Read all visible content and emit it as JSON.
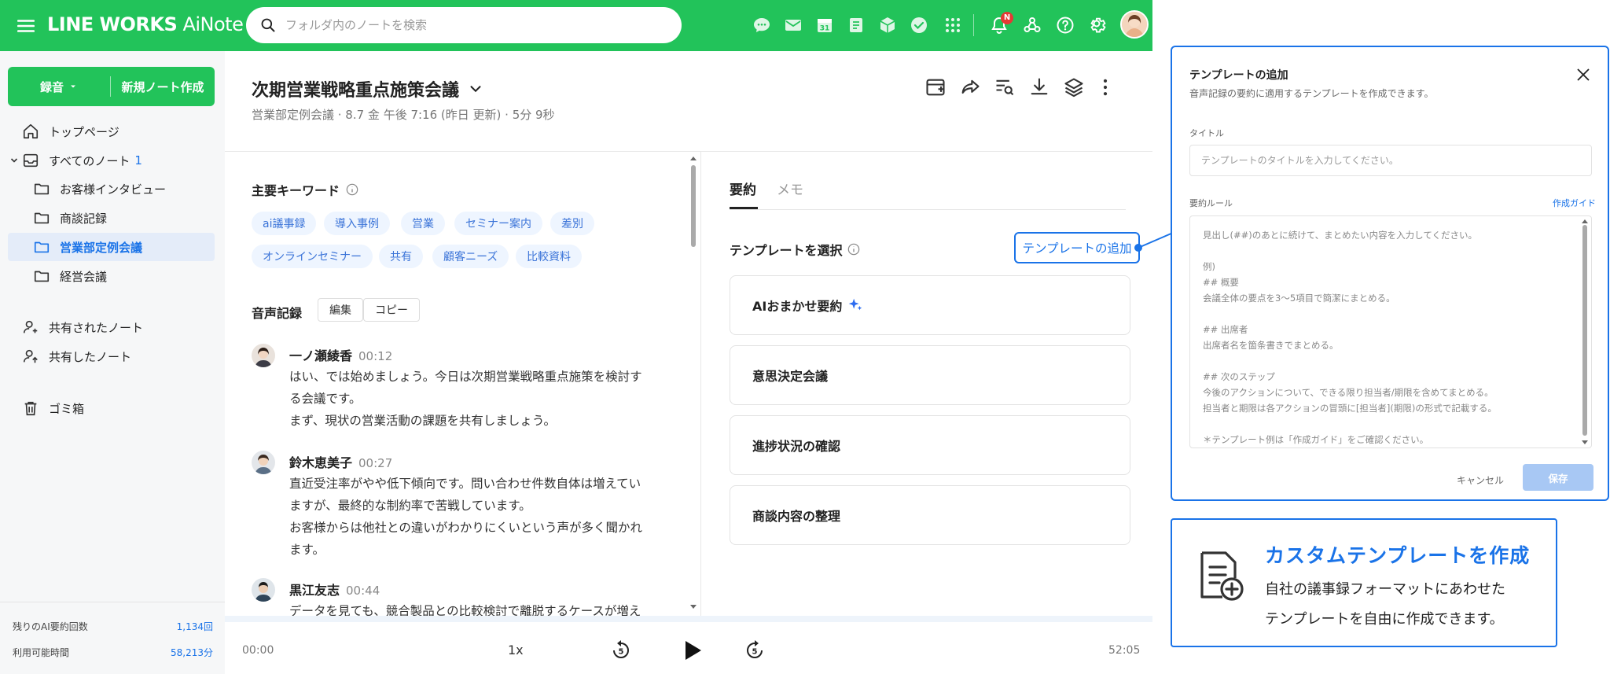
{
  "topbar": {
    "brand": "LINE WORKS",
    "product": "AiNote",
    "search_placeholder": "フォルダ内のノートを検索",
    "notification_badge": "N"
  },
  "sidebar": {
    "record_label": "録音",
    "new_note_label": "新規ノート作成",
    "items": [
      {
        "label": "トップページ"
      },
      {
        "label": "すべてのノート",
        "count": "1"
      },
      {
        "label": "お客様インタビュー"
      },
      {
        "label": "商談記録"
      },
      {
        "label": "営業部定例会議"
      },
      {
        "label": "経営会議"
      },
      {
        "label": "共有されたノート"
      },
      {
        "label": "共有したノート"
      },
      {
        "label": "ゴミ箱"
      }
    ],
    "stats": [
      {
        "label": "残りのAI要約回数",
        "value": "1,134回"
      },
      {
        "label": "利用可能時間",
        "value": "58,213分"
      }
    ]
  },
  "note": {
    "title": "次期営業戦略重点施策会議",
    "meta": "営業部定例会議 · 8.7 金 午後 7:16 (昨日 更新) · 5分 9秒"
  },
  "keywords": {
    "heading": "主要キーワード",
    "items": [
      "ai議事録",
      "導入事例",
      "営業",
      "セミナー案内",
      "差別",
      "オンラインセミナー",
      "共有",
      "顧客ニーズ",
      "比較資料"
    ]
  },
  "transcript": {
    "heading": "音声記録",
    "edit_label": "編集",
    "copy_label": "コピー",
    "entries": [
      {
        "speaker": "一ノ瀬綾香",
        "time": "00:12",
        "lines": [
          "はい、では始めましょう。今日は次期営業戦略重点施策を検討す",
          "る会議です。",
          "まず、現状の営業活動の課題を共有しましょう。"
        ]
      },
      {
        "speaker": "鈴木恵美子",
        "time": "00:27",
        "lines": [
          "直近受注率がやや低下傾向です。問い合わせ件数自体は増えてい",
          "ますが、最終的な制約率で苦戦しています。",
          "お客様からは他社との違いがわかりにくいという声が多く聞かれ",
          "ます。"
        ]
      },
      {
        "speaker": "黒江友志",
        "time": "00:44",
        "lines": [
          "データを見ても、競合製品との比較検討で離脱するケースが増え"
        ]
      }
    ]
  },
  "summary": {
    "tab_summary": "要約",
    "tab_memo": "メモ",
    "select_label": "テンプレートを選択",
    "add_template_label": "テンプレートの追加",
    "templates": [
      "AIおまかせ要約",
      "意思決定会議",
      "進捗状況の確認",
      "商談内容の整理"
    ]
  },
  "player": {
    "current": "00:00",
    "speed": "1x",
    "total": "52:05"
  },
  "modal": {
    "title": "テンプレートの追加",
    "subtitle": "音声記録の要約に適用するテンプレートを作成できます。",
    "title_label": "タイトル",
    "title_placeholder": "テンプレートのタイトルを入力してください。",
    "rule_label": "要約ルール",
    "guide_link": "作成ガイド",
    "rule_lines": [
      "見出し(##)のあとに続けて、まとめたい内容を入力してください。",
      "",
      "例)",
      "## 概要",
      "会議全体の要点を3〜5項目で簡潔にまとめる。",
      "",
      "## 出席者",
      "出席者名を箇条書きでまとめる。",
      "",
      "## 次のステップ",
      "今後のアクションについて、できる限り担当者/期限を含めてまとめる。",
      "担当者と期限は各アクションの冒頭に[担当者](期限)の形式で記載する。",
      "",
      "＊テンプレート例は「作成ガイド」をご確認ください。"
    ],
    "cancel_label": "キャンセル",
    "save_label": "保存"
  },
  "promo": {
    "title": "カスタムテンプレートを作成",
    "line1": "自社の議事録フォーマットにあわせた",
    "line2": "テンプレートを自由に作成できます。"
  },
  "colors": {
    "brand_green": "#22c35a",
    "accent_blue": "#1a73e8"
  }
}
